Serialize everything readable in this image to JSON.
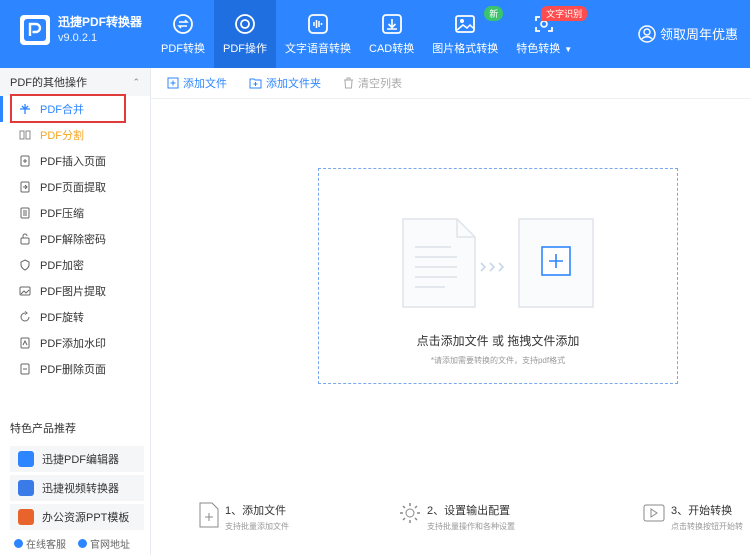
{
  "app": {
    "name": "迅捷PDF转换器",
    "version": "v9.0.2.1"
  },
  "nav": [
    {
      "label": "PDF转换",
      "icon": "pdf-convert-icon"
    },
    {
      "label": "PDF操作",
      "icon": "pdf-operate-icon",
      "active": true
    },
    {
      "label": "文字语音转换",
      "icon": "voice-icon"
    },
    {
      "label": "CAD转换",
      "icon": "cad-icon"
    },
    {
      "label": "图片格式转换",
      "icon": "image-icon",
      "badge": "新"
    },
    {
      "label": "特色转换",
      "icon": "feature-icon",
      "badge": "文字识别"
    }
  ],
  "promo": {
    "label": "领取周年优惠"
  },
  "sidebar": {
    "header": "PDF的其他操作",
    "items": [
      {
        "label": "PDF合并"
      },
      {
        "label": "PDF分割"
      },
      {
        "label": "PDF插入页面"
      },
      {
        "label": "PDF页面提取"
      },
      {
        "label": "PDF压缩"
      },
      {
        "label": "PDF解除密码"
      },
      {
        "label": "PDF加密"
      },
      {
        "label": "PDF图片提取"
      },
      {
        "label": "PDF旋转"
      },
      {
        "label": "PDF添加水印"
      },
      {
        "label": "PDF删除页面"
      }
    ],
    "recommend_title": "特色产品推荐",
    "recommend": [
      {
        "label": "迅捷PDF编辑器"
      },
      {
        "label": "迅捷视频转换器"
      },
      {
        "label": "办公资源PPT模板"
      }
    ],
    "footer": {
      "online_service": "在线客服",
      "website": "官网地址"
    }
  },
  "toolbar": {
    "add_file": "添加文件",
    "add_folder": "添加文件夹",
    "clear_list": "清空列表"
  },
  "dropzone": {
    "title": "点击添加文件 或 拖拽文件添加",
    "hint": "*请添加需要转换的文件，支持pdf格式"
  },
  "steps": [
    {
      "title": "1、添加文件",
      "desc": "支持批量添加文件"
    },
    {
      "title": "2、设置输出配置",
      "desc": "支持批量操作和各种设置"
    },
    {
      "title": "3、开始转换",
      "desc": "点击转换按钮开始转"
    }
  ],
  "colors": {
    "primary": "#2d86ff",
    "highlight": "#e03a3a",
    "orange": "#f5a623"
  }
}
